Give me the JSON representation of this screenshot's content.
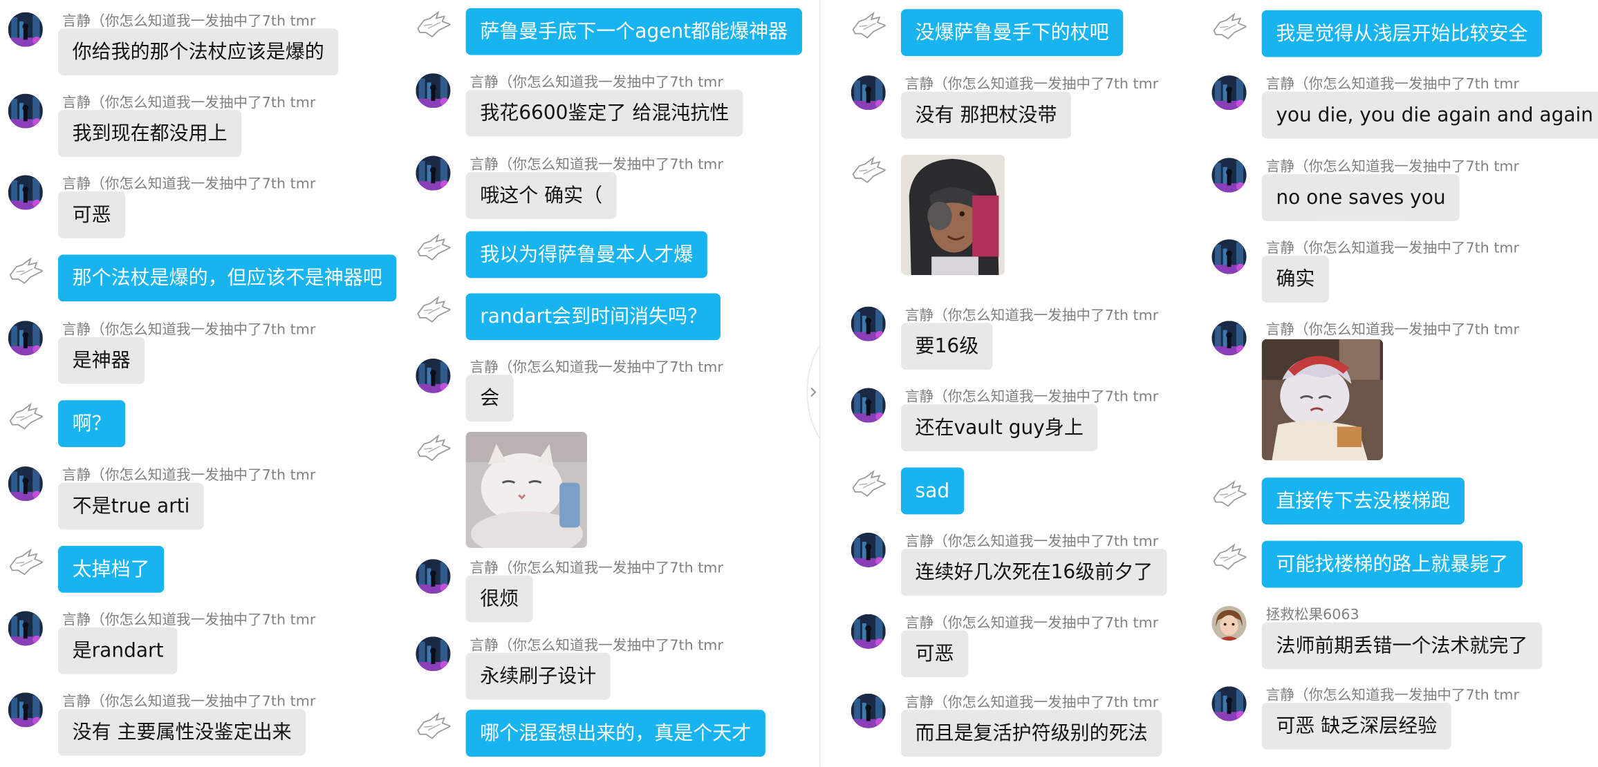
{
  "columns": [
    {
      "messages": [
        {
          "who": "user",
          "name": "言静（你怎么知道我一发抽中了7th tmr",
          "text": "你给我的那个法杖应该是爆的"
        },
        {
          "who": "user",
          "name": "言静（你怎么知道我一发抽中了7th tmr",
          "text": "我到现在都没用上"
        },
        {
          "who": "user",
          "name": "言静（你怎么知道我一发抽中了7th tmr",
          "text": "可恶"
        },
        {
          "who": "self",
          "text": "那个法杖是爆的，但应该不是神器吧"
        },
        {
          "who": "user",
          "name": "言静（你怎么知道我一发抽中了7th tmr",
          "text": "是神器"
        },
        {
          "who": "self",
          "text": "啊？"
        },
        {
          "who": "user",
          "name": "言静（你怎么知道我一发抽中了7th tmr",
          "text": "不是true arti"
        },
        {
          "who": "self",
          "text": "太掉档了"
        },
        {
          "who": "user",
          "name": "言静（你怎么知道我一发抽中了7th tmr",
          "text": "是randart"
        },
        {
          "who": "user",
          "name": "言静（你怎么知道我一发抽中了7th tmr",
          "text": "没有 主要属性没鉴定出来"
        }
      ]
    },
    {
      "messages": [
        {
          "who": "self",
          "text": "萨鲁曼手底下一个agent都能爆神器"
        },
        {
          "who": "user",
          "name": "言静（你怎么知道我一发抽中了7th tmr",
          "text": "我花6600鉴定了 给混沌抗性"
        },
        {
          "who": "user",
          "name": "言静（你怎么知道我一发抽中了7th tmr",
          "text": "哦这个 确实（"
        },
        {
          "who": "self",
          "text": " 我以为得萨鲁曼本人才爆"
        },
        {
          "who": "self",
          "text": "randart会到时间消失吗？"
        },
        {
          "who": "user",
          "name": "言静（你怎么知道我一发抽中了7th tmr",
          "text": "会"
        },
        {
          "who": "self",
          "image": "cat-sticker"
        },
        {
          "who": "user",
          "name": "言静（你怎么知道我一发抽中了7th tmr",
          "text": "很烦"
        },
        {
          "who": "user",
          "name": "言静（你怎么知道我一发抽中了7th tmr",
          "text": "永续刷子设计"
        },
        {
          "who": "self",
          "text": "哪个混蛋想出来的，真是个天才"
        }
      ]
    },
    {
      "messages": [
        {
          "who": "self",
          "text": "没爆萨鲁曼手下的杖吧"
        },
        {
          "who": "user",
          "name": "言静（你怎么知道我一发抽中了7th tmr",
          "text": "没有 那把杖没带"
        },
        {
          "who": "self",
          "image": "hooded-man-sticker"
        },
        {
          "who": "user",
          "name": "言静（你怎么知道我一发抽中了7th tmr",
          "text": "要16级"
        },
        {
          "who": "user",
          "name": "言静（你怎么知道我一发抽中了7th tmr",
          "text": "还在vault guy身上"
        },
        {
          "who": "self",
          "text": "sad"
        },
        {
          "who": "user",
          "name": "言静（你怎么知道我一发抽中了7th tmr",
          "text": "连续好几次死在16级前夕了"
        },
        {
          "who": "user",
          "name": "言静（你怎么知道我一发抽中了7th tmr",
          "text": "可恶"
        },
        {
          "who": "user",
          "name": "言静（你怎么知道我一发抽中了7th tmr",
          "text": "而且是复活护符级别的死法"
        }
      ]
    },
    {
      "messages": [
        {
          "who": "self",
          "text": "我是觉得从浅层开始比较安全"
        },
        {
          "who": "user",
          "name": "言静（你怎么知道我一发抽中了7th tmr",
          "text": "you die, you die again and again"
        },
        {
          "who": "user",
          "name": "言静（你怎么知道我一发抽中了7th tmr",
          "text": "no one saves you"
        },
        {
          "who": "user",
          "name": "言静（你怎么知道我一发抽中了7th tmr",
          "text": "确实"
        },
        {
          "who": "user",
          "name": "言静（你怎么知道我一发抽中了7th tmr",
          "image": "anime-girl-sticker"
        },
        {
          "who": "self",
          "text": "直接传下去没楼梯跑"
        },
        {
          "who": "self",
          "text": "可能找楼梯的路上就暴毙了"
        },
        {
          "who": "other",
          "name": "拯救松果6063",
          "text": "法师前期丢错一个法术就完了"
        },
        {
          "who": "user",
          "name": "言静（你怎么知道我一发抽中了7th tmr",
          "text": "可恶 缺乏深层经验"
        }
      ]
    }
  ],
  "colors": {
    "self_bubble": "#17b4f0",
    "user_bubble": "#e8e8e8",
    "name": "#808080"
  }
}
